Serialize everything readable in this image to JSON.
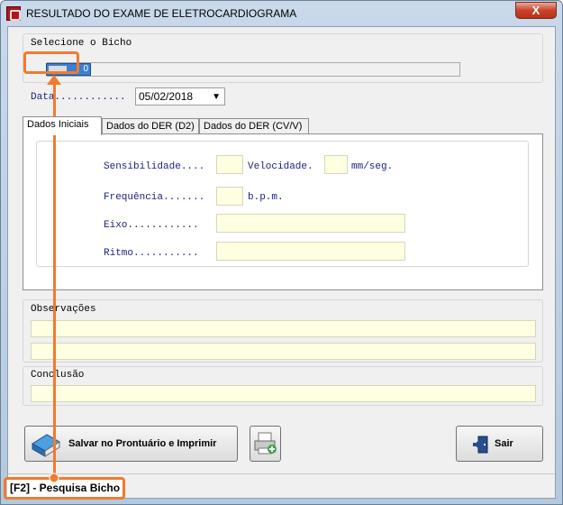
{
  "window": {
    "title": "RESULTADO DO EXAME DE ELETROCARDIOGRAMA",
    "close_label": "X"
  },
  "bicho": {
    "label": "Selecione o Bicho",
    "code": "0",
    "name": ""
  },
  "data": {
    "label": "Data............",
    "value": "05/02/2018"
  },
  "tabs": [
    {
      "label": "Dados Iniciais",
      "active": true
    },
    {
      "label": "Dados do DER (D2)",
      "active": false
    },
    {
      "label": "Dados do DER (CV/V)",
      "active": false
    }
  ],
  "fields": {
    "sensibilidade_label": "Sensibilidade....",
    "velocidade_label": "Velocidade.",
    "velocidade_unit": "mm/seg.",
    "frequencia_label": "Frequência.......",
    "frequencia_unit": "b.p.m.",
    "eixo_label": "Eixo............",
    "ritmo_label": "Ritmo...........",
    "sensibilidade": "",
    "velocidade": "",
    "frequencia": "",
    "eixo": "",
    "ritmo": ""
  },
  "observacoes": {
    "label": "Observações",
    "line1": "",
    "line2": ""
  },
  "conclusao": {
    "label": "Conclusão",
    "value": ""
  },
  "buttons": {
    "save_print": "Salvar no Prontuário e Imprimir",
    "print_icon_name": "printer-icon",
    "exit": "Sair"
  },
  "status": {
    "text": "[F2] - Pesquisa Bicho"
  },
  "colors": {
    "highlight": "#f07b2f",
    "field_bg": "#ffffe1",
    "label_blue": "#1a237e"
  }
}
